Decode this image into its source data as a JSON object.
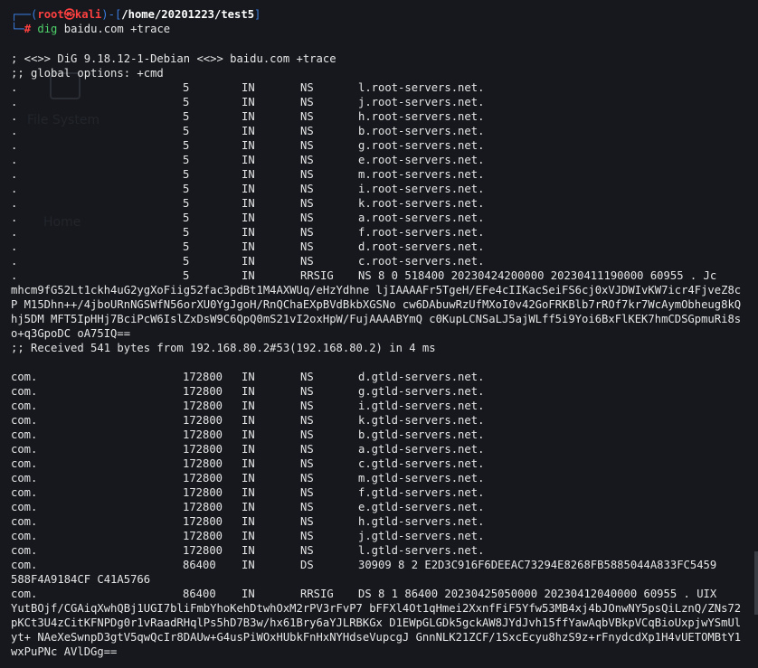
{
  "prompt": {
    "user": "root",
    "at": "㉿",
    "host": "kali",
    "path": "/home/20201223/test5",
    "symbol": "#",
    "command_bin": "dig",
    "command_args": "baidu.com +trace"
  },
  "desktop": {
    "label1": "File System",
    "label2": "Home"
  },
  "header_lines": [
    "; <<>> DiG 9.18.12-1-Debian <<>> baidu.com +trace",
    ";; global options: +cmd"
  ],
  "root_records": [
    [
      ".",
      "5",
      "IN",
      "NS",
      "l.root-servers.net."
    ],
    [
      ".",
      "5",
      "IN",
      "NS",
      "j.root-servers.net."
    ],
    [
      ".",
      "5",
      "IN",
      "NS",
      "h.root-servers.net."
    ],
    [
      ".",
      "5",
      "IN",
      "NS",
      "b.root-servers.net."
    ],
    [
      ".",
      "5",
      "IN",
      "NS",
      "g.root-servers.net."
    ],
    [
      ".",
      "5",
      "IN",
      "NS",
      "e.root-servers.net."
    ],
    [
      ".",
      "5",
      "IN",
      "NS",
      "m.root-servers.net."
    ],
    [
      ".",
      "5",
      "IN",
      "NS",
      "i.root-servers.net."
    ],
    [
      ".",
      "5",
      "IN",
      "NS",
      "k.root-servers.net."
    ],
    [
      ".",
      "5",
      "IN",
      "NS",
      "a.root-servers.net."
    ],
    [
      ".",
      "5",
      "IN",
      "NS",
      "f.root-servers.net."
    ],
    [
      ".",
      "5",
      "IN",
      "NS",
      "d.root-servers.net."
    ],
    [
      ".",
      "5",
      "IN",
      "NS",
      "c.root-servers.net."
    ],
    [
      ".",
      "5",
      "IN",
      "RRSIG",
      "NS 8 0 518400 20230424200000 20230411190000 60955 . Jc"
    ]
  ],
  "root_rrsig_body": "mhcm9fG52Lt1ckh4uG2ygXoFiig52fac3pdBt1M4AXWUq/eHzYdhne ljIAAAAFr5TgeH/EFe4cIIKacSeiFS6cj0xVJDWIvKW7icr4FjveZ8cP M15Dhn++/4jboURnNGSWfN56orXU0YgJgoH/RnQChaEXpBVdBkbXGSNo cw6DAbuwRzUfMXoI0v42GoFRKBlb7rROf7kr7WcAymObheug8kQhj5DM MFT5IpHHj7BciPcW6IslZxDsW9C6QpQ0mS21vI2oxHpW/FujAAAABYmQ c0KupLCNSaLJ5ajWLff5i9Yoi6BxFlKEK7hmCDSGpmuRi8so+q3GpoDC oA75IQ==",
  "received_line": ";; Received 541 bytes from 192.168.80.2#53(192.168.80.2) in 4 ms",
  "com_records": [
    [
      "com.",
      "172800",
      "IN",
      "NS",
      "d.gtld-servers.net."
    ],
    [
      "com.",
      "172800",
      "IN",
      "NS",
      "g.gtld-servers.net."
    ],
    [
      "com.",
      "172800",
      "IN",
      "NS",
      "i.gtld-servers.net."
    ],
    [
      "com.",
      "172800",
      "IN",
      "NS",
      "k.gtld-servers.net."
    ],
    [
      "com.",
      "172800",
      "IN",
      "NS",
      "b.gtld-servers.net."
    ],
    [
      "com.",
      "172800",
      "IN",
      "NS",
      "a.gtld-servers.net."
    ],
    [
      "com.",
      "172800",
      "IN",
      "NS",
      "c.gtld-servers.net."
    ],
    [
      "com.",
      "172800",
      "IN",
      "NS",
      "m.gtld-servers.net."
    ],
    [
      "com.",
      "172800",
      "IN",
      "NS",
      "f.gtld-servers.net."
    ],
    [
      "com.",
      "172800",
      "IN",
      "NS",
      "e.gtld-servers.net."
    ],
    [
      "com.",
      "172800",
      "IN",
      "NS",
      "h.gtld-servers.net."
    ],
    [
      "com.",
      "172800",
      "IN",
      "NS",
      "j.gtld-servers.net."
    ],
    [
      "com.",
      "172800",
      "IN",
      "NS",
      "l.gtld-servers.net."
    ],
    [
      "com.",
      "86400",
      "IN",
      "DS",
      "30909 8 2 E2D3C916F6DEEAC73294E8268FB5885044A833FC5459"
    ]
  ],
  "ds_tail": "588F4A9184CF C41A5766",
  "com_rrsig": [
    "com.",
    "86400",
    "IN",
    "RRSIG",
    "DS 8 1 86400 20230425050000 20230412040000 60955 . UIX"
  ],
  "com_rrsig_body": "YutBOjf/CGAiqXwhQBj1UGI7bliFmbYhoKehDtwhOxM2rPV3rFvP7 bFFXl4Ot1qHmei2XxnfFiF5Yfw53MB4xj4bJOnwNY5psQiLznQ/ZNs72 pKCt3U4zCitKFNPDg0r1vRaadRHqlPs5hD7B3w/hx61Bry6aYJLRBKGx D1EWpGLGDk5gckAW8JYdJvh15ffYawAqbVBkpVCqBioUxpjwYSmUlyt+ NAeXeSwnpD3gtV5qwQcIr8DAUw+G4usPiWOxHUbkFnHxNYHdseVupcgJ GnnNLK21ZCF/1SxcEcyu8hzS9z+rFnydcdXp1H4vUETOMBtY1wxPuPNc AVlDGg=="
}
